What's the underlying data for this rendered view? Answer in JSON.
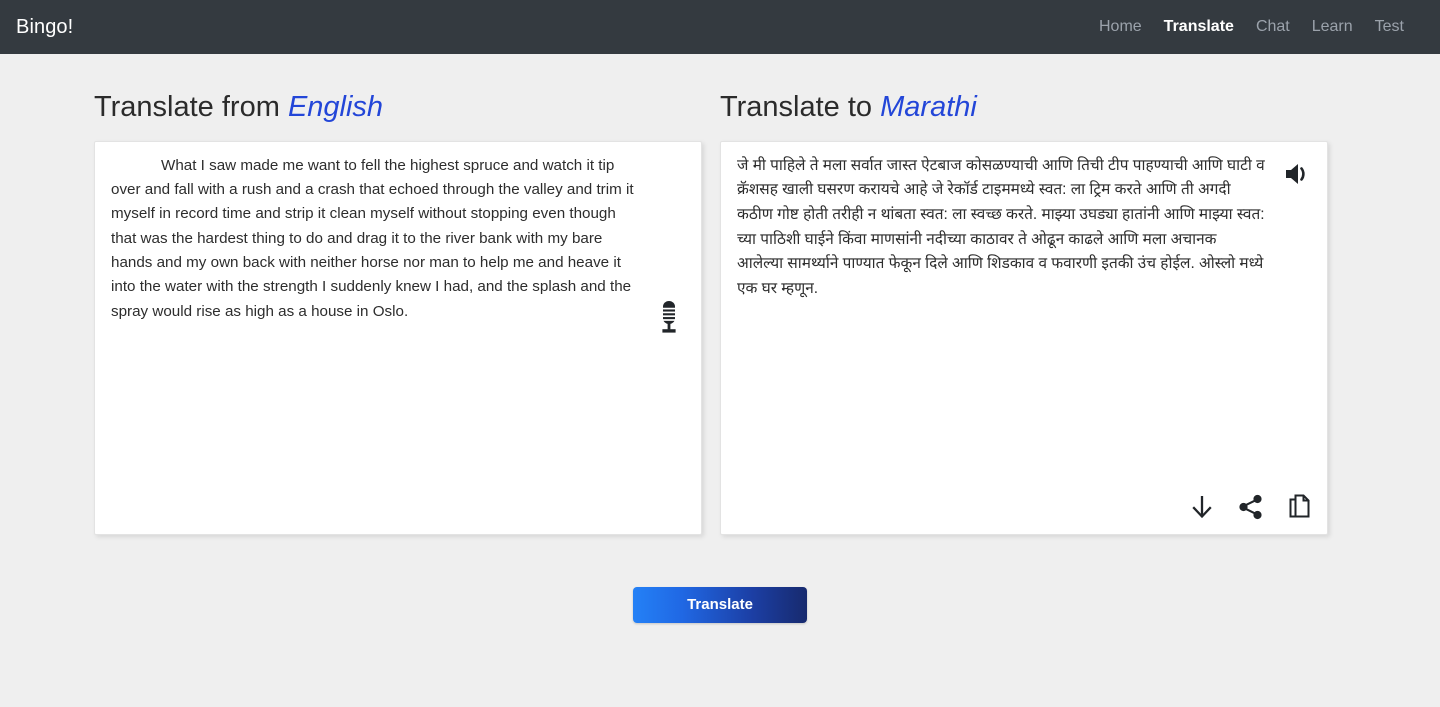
{
  "navbar": {
    "brand": "Bingo!",
    "links": [
      {
        "label": "Home",
        "active": false
      },
      {
        "label": "Translate",
        "active": true
      },
      {
        "label": "Chat",
        "active": false
      },
      {
        "label": "Learn",
        "active": false
      },
      {
        "label": "Test",
        "active": false
      }
    ]
  },
  "source": {
    "title_prefix": "Translate from",
    "language": "English",
    "text": "What I saw made me want to fell the highest spruce and watch it tip over and fall with a rush and a crash that echoed through the valley and trim it myself in record time and strip it clean myself without stopping even though that was the hardest thing to do and drag it to the river bank with my bare hands and my own back with neither horse nor man to help me and heave it into the water with the strength I suddenly knew I had, and the splash and the spray would rise as high as a house in Oslo.",
    "placeholder": "",
    "mic_icon": "microphone-icon"
  },
  "target": {
    "title_prefix": "Translate to",
    "language": "Marathi",
    "text": "जे मी पाहिले ते मला सर्वात जास्त ऐटबाज कोसळण्याची आणि तिची टीप पाहण्याची आणि घाटी व क्रॅशसह खाली घसरण करायचे आहे जे रेकॉर्ड टाइममध्ये स्वत: ला ट्रिम करते आणि ती अगदी कठीण गोष्ट होती तरीही न थांबता स्वत: ला स्वच्छ करते. माझ्या उघड्या हातांनी आणि माझ्या स्वत: च्या पाठिशी घाईने किंवा माणसांनी नदीच्या काठावर ते ओढून काढले आणि मला अचानक आलेल्या सामर्थ्याने पाण्यात फेकून दिले आणि शिडकाव व फवारणी इतकी उंच होईल. ओस्लो मध्ये एक घर म्हणून.",
    "placeholder": "",
    "speaker_icon": "speaker-icon",
    "actions": [
      {
        "name": "download-icon"
      },
      {
        "name": "share-icon"
      },
      {
        "name": "copy-icon"
      }
    ]
  },
  "actions": {
    "translate_label": "Translate"
  },
  "colors": {
    "navbar_bg": "#343a40",
    "page_bg": "#efefef",
    "accent_blue": "#2346d8",
    "button_gradient_start": "#2481f6",
    "button_gradient_end": "#172a6e",
    "nav_inactive": "#9ba2ab",
    "nav_active": "#ffffff"
  }
}
